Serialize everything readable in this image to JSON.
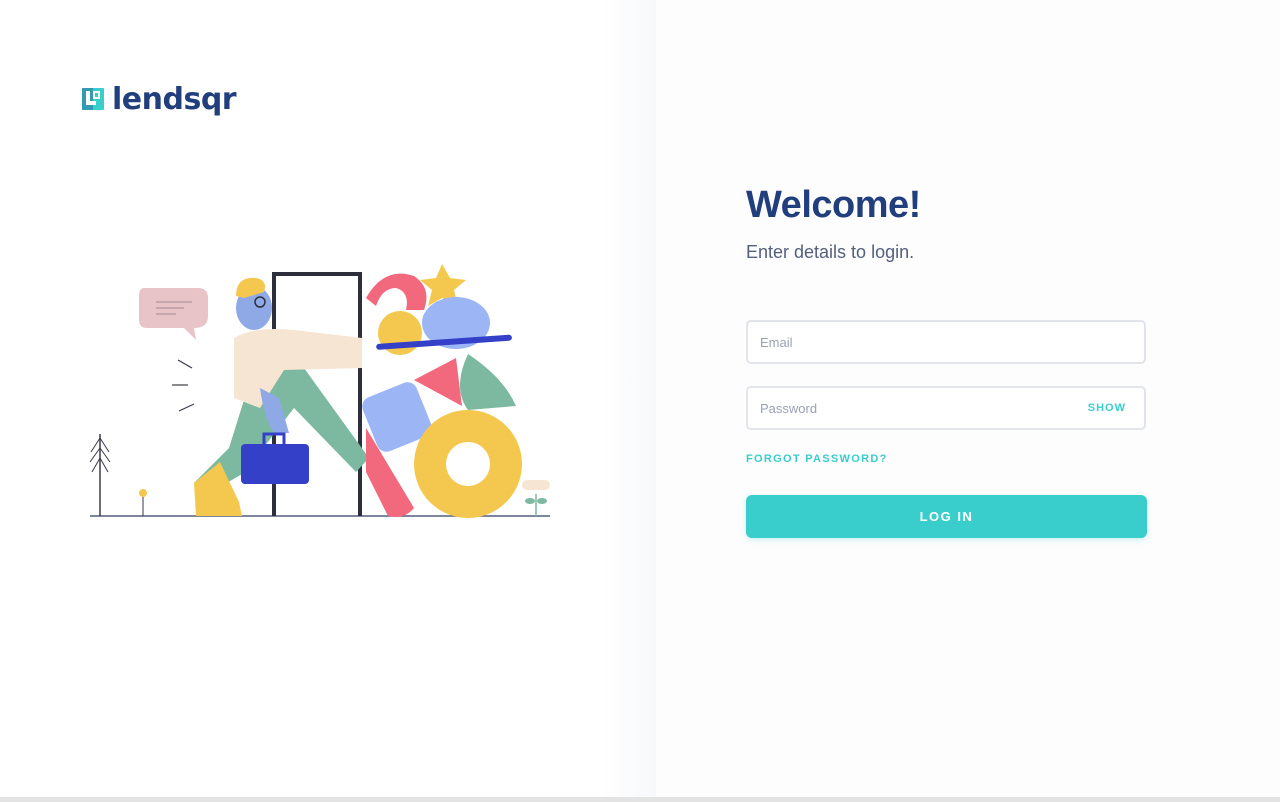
{
  "brand": {
    "name": "lendsqr",
    "logo_icon": "lendsqr-logo-mark",
    "color": "#213f7d",
    "accent": "#39cdcc"
  },
  "illustration": {
    "icon": "login-illustration"
  },
  "login": {
    "title": "Welcome!",
    "subtitle": "Enter details to login.",
    "email_placeholder": "Email",
    "password_placeholder": "Password",
    "show_label": "SHOW",
    "forgot_label": "FORGOT PASSWORD?",
    "submit_label": "LOG IN"
  }
}
